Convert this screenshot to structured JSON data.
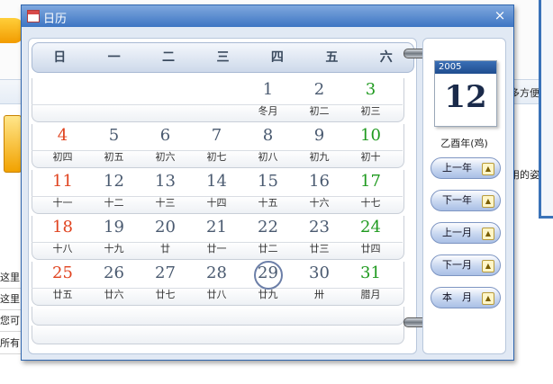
{
  "background": {
    "nav_right_text": "多方便",
    "side_text": "用的姿",
    "lines": [
      "这里",
      "这里",
      "您可",
      "所有"
    ]
  },
  "dialog": {
    "title": "日历",
    "close_glyph": "×"
  },
  "weekdays": [
    "日",
    "一",
    "二",
    "三",
    "四",
    "五",
    "六"
  ],
  "weeks": [
    [
      {
        "day": "",
        "lunar": ""
      },
      {
        "day": "",
        "lunar": ""
      },
      {
        "day": "",
        "lunar": ""
      },
      {
        "day": "",
        "lunar": ""
      },
      {
        "day": "1",
        "lunar": "冬月"
      },
      {
        "day": "2",
        "lunar": "初二"
      },
      {
        "day": "3",
        "lunar": "初三"
      }
    ],
    [
      {
        "day": "4",
        "lunar": "初四"
      },
      {
        "day": "5",
        "lunar": "初五"
      },
      {
        "day": "6",
        "lunar": "初六"
      },
      {
        "day": "7",
        "lunar": "初七"
      },
      {
        "day": "8",
        "lunar": "初八"
      },
      {
        "day": "9",
        "lunar": "初九"
      },
      {
        "day": "10",
        "lunar": "初十"
      }
    ],
    [
      {
        "day": "11",
        "lunar": "十一"
      },
      {
        "day": "12",
        "lunar": "十二"
      },
      {
        "day": "13",
        "lunar": "十三"
      },
      {
        "day": "14",
        "lunar": "十四"
      },
      {
        "day": "15",
        "lunar": "十五"
      },
      {
        "day": "16",
        "lunar": "十六"
      },
      {
        "day": "17",
        "lunar": "十七"
      }
    ],
    [
      {
        "day": "18",
        "lunar": "十八"
      },
      {
        "day": "19",
        "lunar": "十九"
      },
      {
        "day": "20",
        "lunar": "廿"
      },
      {
        "day": "21",
        "lunar": "廿一"
      },
      {
        "day": "22",
        "lunar": "廿二"
      },
      {
        "day": "23",
        "lunar": "廿三"
      },
      {
        "day": "24",
        "lunar": "廿四"
      }
    ],
    [
      {
        "day": "25",
        "lunar": "廿五"
      },
      {
        "day": "26",
        "lunar": "廿六"
      },
      {
        "day": "27",
        "lunar": "廿七"
      },
      {
        "day": "28",
        "lunar": "廿八"
      },
      {
        "day": "29",
        "lunar": "廿九"
      },
      {
        "day": "30",
        "lunar": "卅"
      },
      {
        "day": "31",
        "lunar": "腊月"
      }
    ]
  ],
  "today_day": "29",
  "side": {
    "year": "2005",
    "big_day": "12",
    "ganzhi": "乙酉年(鸡)",
    "buttons": [
      "上一年",
      "下一年",
      "上一月",
      "下一月",
      "本　月"
    ]
  },
  "colors": {
    "sunday": "#e0431f",
    "saturday": "#1f9a1f",
    "weekday": "#4a5a70",
    "title_bar": "#3d75c3"
  }
}
